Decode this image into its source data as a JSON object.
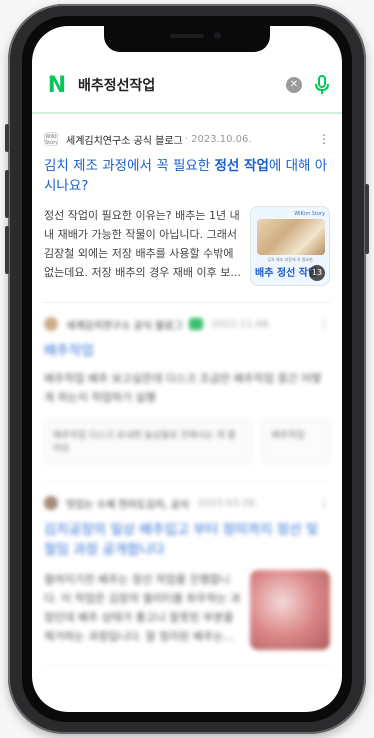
{
  "search": {
    "logo": "N",
    "query": "배추정선작업",
    "clear_glyph": "✕"
  },
  "results": [
    {
      "source_icon_text": "WIKI Story",
      "source_name": "세계김치연구소 공식 블로그",
      "date": "· 2023.10.06.",
      "more": "⋮",
      "title_pre": "김치 제조 과정에서 꼭 필요한 ",
      "title_bold": "정선 작업",
      "title_post": "에 대해 아시나요?",
      "snippet": "정선 작업이 필요한 이유는? 배추는 1년 내내 재배가 가능한 작물이 아닙니다. 그래서 김장철 외에는 저장 배추를 사용할 수밖에 없는데요. 저장 배추의 경우 재배 이후 보...",
      "thumb_tag": "WIKim Story",
      "thumb_caption": "김치 제조 과정에 꼭 필요한",
      "thumb_big": "배추 정선 작업",
      "image_count": "13"
    },
    {
      "source_name": "세계김치연구소 공식 블로그",
      "date": "· 2022.11.08.",
      "more": "⋮",
      "title": "배추작업",
      "snippet": "배추작업 배추 보고싶은데 다스크 조금만 배추작업 중간 어떻게 하는지 작업하기 실행",
      "chips": [
        "배추작업 다스크 보내면 늘상블로 전해시는 게 좋아요",
        "배추작업"
      ]
    },
    {
      "source_name": "맛있는 수제 전라도김치, 공식",
      "date": "· 2023.03.28.",
      "more": "⋮",
      "title": "김치공장의 일상 배추입고 부터 정미까지 정선 및 절임 과정 공개합니다",
      "snippet": "절여지기전 배추는 정선 작업을 진행합니다. 이 작업은 김장의 퀄리티를 좌우하는 과정인데 배추 상태가 좋고나 잘못된 부분을 제거하는 과정입니다. 잘 정리된 배추는..."
    }
  ],
  "colors": {
    "brand": "#03c75a",
    "link": "#1a5fd0",
    "divider": "#d6eedd"
  }
}
